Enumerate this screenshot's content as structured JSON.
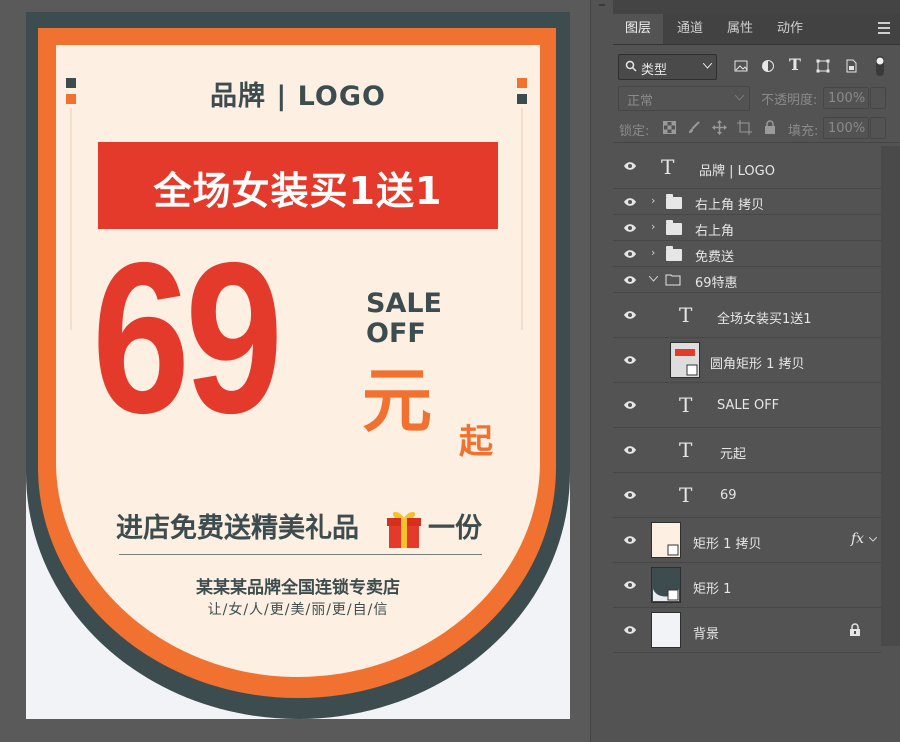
{
  "canvas": {
    "brand_title": "品牌 | LOGO",
    "banner_text": "全场女装买1送1",
    "big_price": "69",
    "sale_line1": "SALE",
    "sale_line2": "OFF",
    "currency": "元",
    "currency_suffix": "起",
    "promo_text": "进店免费送精美礼品",
    "promo_suffix": "一份",
    "store_text": "某某某品牌全国连锁专卖店",
    "slogan_text": "让/女/人/更/美/丽/更/自/信",
    "colors": {
      "red": "#e33a2c",
      "orange": "#f07130",
      "dark_teal": "#3d4d4f",
      "cream": "#fdf0e2"
    }
  },
  "panel": {
    "tabs": [
      {
        "label": "图层",
        "active": true
      },
      {
        "label": "通道",
        "active": false
      },
      {
        "label": "属性",
        "active": false
      },
      {
        "label": "动作",
        "active": false
      }
    ],
    "filter_label": "类型",
    "blend_mode": "正常",
    "opacity_label": "不透明度:",
    "opacity_value": "100%",
    "lock_label": "锁定:",
    "fill_label": "填充:",
    "fill_value": "100%",
    "layers": [
      {
        "name": "品牌 | LOGO",
        "kind": "text",
        "icon": "text-layer-icon"
      },
      {
        "name": "右上角 拷贝",
        "kind": "group",
        "icon": "folder-icon"
      },
      {
        "name": "右上角",
        "kind": "group",
        "icon": "folder-icon"
      },
      {
        "name": "免费送",
        "kind": "group",
        "icon": "folder-icon"
      },
      {
        "name": "69特惠",
        "kind": "group",
        "expanded": true,
        "icon": "folder-open-icon"
      },
      {
        "name": "全场女装买1送1",
        "kind": "text",
        "icon": "text-layer-icon"
      },
      {
        "name": "圆角矩形 1 拷贝",
        "kind": "shape",
        "icon": "shape-thumbnail"
      },
      {
        "name": "SALE OFF",
        "kind": "text",
        "icon": "text-layer-icon"
      },
      {
        "name": "元起",
        "kind": "text",
        "icon": "text-layer-icon"
      },
      {
        "name": "69",
        "kind": "text",
        "icon": "text-layer-icon"
      },
      {
        "name": "矩形 1 拷贝",
        "kind": "shape",
        "fx": "fx",
        "icon": "shape-thumbnail"
      },
      {
        "name": "矩形 1",
        "kind": "shape",
        "icon": "shape-thumbnail"
      },
      {
        "name": "背景",
        "kind": "background",
        "locked": true,
        "icon": "lock-icon"
      }
    ]
  }
}
